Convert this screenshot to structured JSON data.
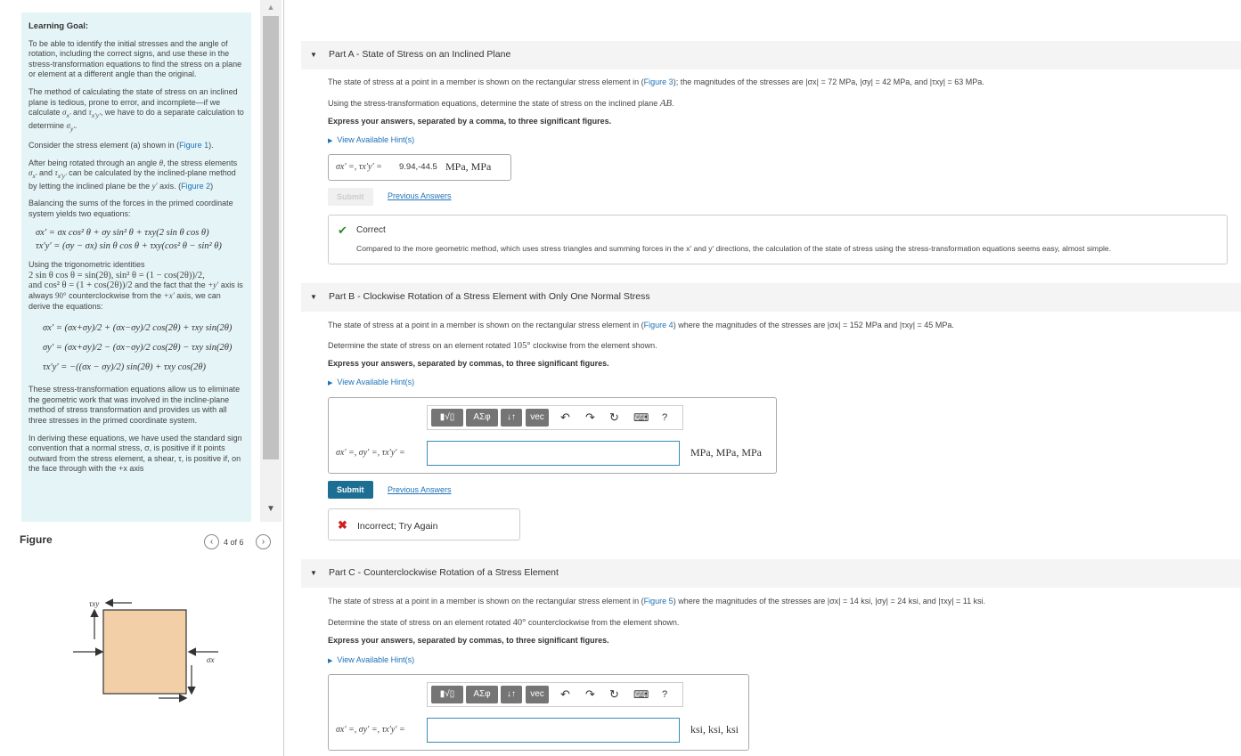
{
  "learning_goal": {
    "title": "Learning Goal:",
    "p1": "To be able to identify the initial stresses and the angle of rotation, including the correct signs, and use these in the stress-transformation equations to find the stress on a plane or element at a different angle than the original.",
    "p2a": "The method of calculating the state of stress on an inclined plane is tedious, prone to error, and incomplete—if we calculate ",
    "p2b": " and ",
    "p2c": ", we have to do a separate calculation to determine ",
    "p3a": "Consider the stress element (a) shown in (",
    "p3link": "Figure 1",
    "p3b": ").",
    "p4a": "After being rotated through an angle ",
    "p4b": ", the stress elements ",
    "p4c": " and ",
    "p4d": " can be calculated by the inclined-plane method by letting the inclined plane be the ",
    "p4e": " axis. (",
    "p4link": "Figure 2",
    "p4f": ")",
    "p5": "Balancing the sums of the forces in the primed coordinate system yields two equations:",
    "eq1": "σx′ = σx cos² θ + σy sin² θ + τxy(2 sin θ cos θ)",
    "eq2": "τx′y′ = (σy − σx) sin θ cos θ + τxy(cos² θ − sin² θ)",
    "p6a": "Using the trigonometric identities",
    "p6b": "2 sin θ cos θ = sin(2θ), sin² θ = (1 − cos(2θ))/2,",
    "p6c": "and cos² θ = (1 + cos(2θ))/2",
    "p6d": " and the fact that the ",
    "p6e": "+y′",
    "p6f": " axis is always ",
    "p6g": "90°",
    "p6h": " counterclockwise from the ",
    "p6i": "+x′",
    "p6j": " axis, we can derive the equations:",
    "eq3": "σx′ = (σx+σy)/2 + (σx−σy)/2 cos(2θ) + τxy sin(2θ)",
    "eq4": "σy′ = (σx+σy)/2 − (σx−σy)/2 cos(2θ) − τxy sin(2θ)",
    "eq5": "τx′y′ = −((σx − σy)/2) sin(2θ) + τxy cos(2θ)",
    "p7": "These stress-transformation equations allow us to eliminate the geometric work that was involved in the incline-plane method of stress transformation and provides us with all three stresses in the primed coordinate system.",
    "p8": "In deriving these equations, we have used the standard sign convention that a normal stress, σ, is positive if it points outward from the stress element, a shear, τ, is positive if, on the face through with the +x axis"
  },
  "figure": {
    "label": "Figure",
    "counter": "4 of 6",
    "label_tau": "τxy",
    "label_sigma": "σx",
    "colors": {
      "fill": "#f2cfa6",
      "stroke": "#333333"
    }
  },
  "part_a": {
    "header": "Part A - State of Stress on an Inclined Plane",
    "statement_a": "The state of stress at a point in a member is shown on the rectangular stress element in (",
    "statement_link": "Figure 3",
    "statement_b": "); the magnitudes of the stresses are |σx| = 72 MPa, |σy| = 42 MPa, and |τxy| = 63 MPa.",
    "line2a": "Using the stress-transformation equations, determine the state of stress on the inclined plane ",
    "line2b": "AB",
    "instruction": "Express your answers, separated by a comma, to three significant figures.",
    "hint": "View Available Hint(s)",
    "answer_label": "σx′ =, τx′y′ =",
    "answer_value": "9.94,-44.5",
    "answer_units": "MPa, MPa",
    "submit": "Submit",
    "previous": "Previous Answers",
    "feedback_title": "Correct",
    "feedback_text": "Compared to the more geometric method, which uses stress triangles and summing forces in the x′ and y′ directions, the calculation of the state of stress using the stress-transformation equations seems easy, almost simple."
  },
  "part_b": {
    "header": "Part B - Clockwise Rotation of a Stress Element with Only One Normal Stress",
    "statement_a": "The state of stress at a point in a member is shown on the rectangular stress element in (",
    "statement_link": "Figure 4",
    "statement_b": ") where the magnitudes of the stresses are |σx| = 152 MPa and |τxy| = 45 MPa.",
    "line2a": "Determine the state of stress on an element rotated ",
    "line2b": "105°",
    "line2c": " clockwise from the element shown.",
    "instruction": "Express your answers, separated by commas, to three significant figures.",
    "hint": "View Available Hint(s)",
    "answer_label": "σx′ =, σy′ =, τx′y′ =",
    "answer_units": "MPa, MPa, MPa",
    "submit": "Submit",
    "previous": "Previous Answers",
    "feedback_title": "Incorrect; Try Again"
  },
  "part_c": {
    "header": "Part C - Counterclockwise Rotation of a Stress Element",
    "statement_a": "The state of stress at a point in a member is shown on the rectangular stress element in (",
    "statement_link": "Figure 5",
    "statement_b": ") where the magnitudes of the stresses are |σx| = 14 ksi, |σy| = 24 ksi, and |τxy| = 11 ksi.",
    "line2a": "Determine the state of stress on an element rotated ",
    "line2b": "40°",
    "line2c": " counterclockwise from the element shown.",
    "instruction": "Express your answers, separated by commas, to three significant figures.",
    "hint": "View Available Hint(s)",
    "answer_label": "σx′ =, σy′ =, τx′y′ =",
    "answer_units": "ksi, ksi, ksi"
  },
  "toolbar": {
    "templates": "▮√▯",
    "greek": "ΑΣφ",
    "arrows": "↓↑",
    "vec": "vec",
    "undo": "↶",
    "redo": "↷",
    "reset": "↻",
    "keyboard": "⌨",
    "help": "?"
  },
  "colors": {
    "accent": "#1d6e93",
    "link": "#1d72b8",
    "correct": "#2e8b2e",
    "incorrect": "#cc2222",
    "goal_bg": "#e5f4f6"
  }
}
